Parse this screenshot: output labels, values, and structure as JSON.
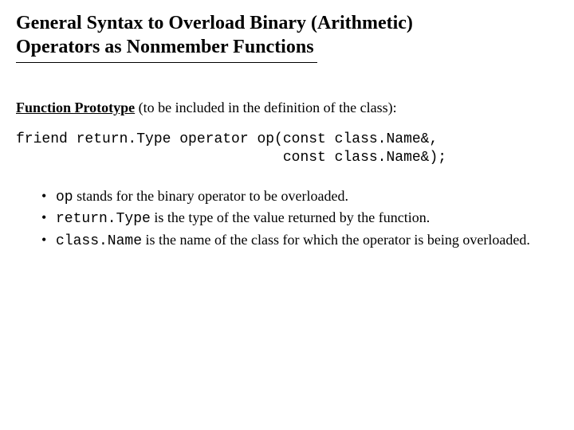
{
  "title_line1": "General Syntax to Overload Binary (Arithmetic)",
  "title_line2": "Operators as Nonmember Functions",
  "subheading_label": "Function Prototype",
  "subheading_rest": " (to be included in the definition of the class):",
  "code_line1": "friend return.Type operator op(const class.Name&,",
  "code_line2": "                               const class.Name&);",
  "bullets": [
    {
      "code": "op",
      "text": " stands for the binary operator to be overloaded."
    },
    {
      "code": "return.Type",
      "text": " is the type of the value returned by the function."
    },
    {
      "code": "class.Name",
      "text": " is the name of the class for which the operator is being overloaded."
    }
  ]
}
